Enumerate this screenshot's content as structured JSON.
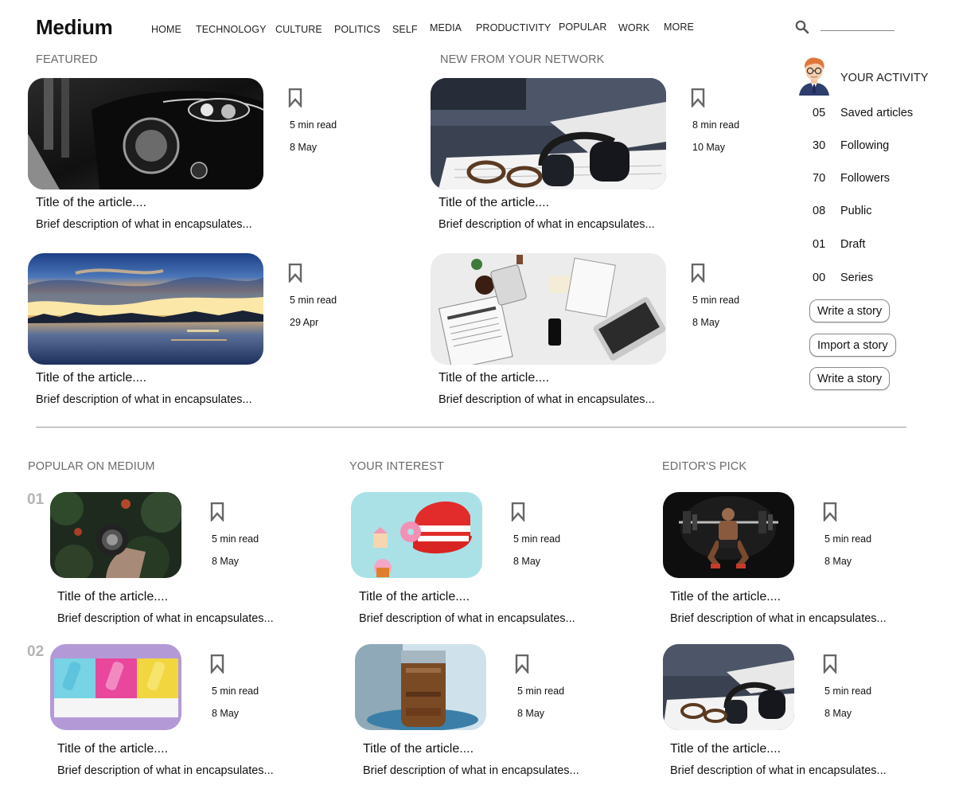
{
  "header": {
    "logo": "Medium",
    "nav": [
      "HOME",
      "TECHNOLOGY",
      "CULTURE",
      "POLITICS",
      "SELF",
      "MEDIA",
      "PRODUCTIVITY",
      "POPULAR",
      "WORK",
      "MORE"
    ],
    "search_icon": "search-icon"
  },
  "featured": {
    "title": "FEATURED",
    "articles": [
      {
        "read_time": "5 min read",
        "date": "8 May",
        "title": "Title of the article....",
        "desc": "Brief description of what in encapsulates..."
      },
      {
        "read_time": "5 min read",
        "date": "29 Apr",
        "title": "Title of the article....",
        "desc": "Brief description of what in encapsulates..."
      }
    ]
  },
  "network": {
    "title": "NEW FROM YOUR NETWORK",
    "articles": [
      {
        "read_time": "8 min read",
        "date": "10 May",
        "title": "Title of the article....",
        "desc": "Brief description of what in encapsulates..."
      },
      {
        "read_time": "5 min read",
        "date": "8 May",
        "title": "Title of the article....",
        "desc": "Brief description of what in encapsulates..."
      }
    ]
  },
  "activity": {
    "title": "YOUR ACTIVITY",
    "stats": [
      {
        "num": "05",
        "label": "Saved articles"
      },
      {
        "num": "30",
        "label": "Following"
      },
      {
        "num": "70",
        "label": "Followers"
      },
      {
        "num": "08",
        "label": "Public"
      },
      {
        "num": "01",
        "label": "Draft"
      },
      {
        "num": "00",
        "label": "Series"
      }
    ],
    "buttons": [
      "Write a story",
      "Import a story",
      "Write a story"
    ]
  },
  "popular": {
    "title": "POPULAR ON MEDIUM",
    "ranks": [
      "01",
      "02"
    ],
    "articles": [
      {
        "read_time": "5 min read",
        "date": "8 May",
        "title": "Title of the article....",
        "desc": "Brief description of what in encapsulates..."
      },
      {
        "read_time": "5 min read",
        "date": "8 May",
        "title": "Title of the article....",
        "desc": "Brief description of what in encapsulates..."
      }
    ]
  },
  "interest": {
    "title": "YOUR INTEREST",
    "articles": [
      {
        "read_time": "5 min read",
        "date": "8 May",
        "title": "Title of the article....",
        "desc": "Brief description of what in encapsulates..."
      },
      {
        "read_time": "5 min read",
        "date": "8 May",
        "title": "Title of the article....",
        "desc": "Brief description of what in encapsulates..."
      }
    ]
  },
  "editors": {
    "title": "EDITOR'S PICK",
    "articles": [
      {
        "read_time": "5 min read",
        "date": "8 May",
        "title": "Title of the article....",
        "desc": "Brief description of what in encapsulates..."
      },
      {
        "read_time": "5 min read",
        "date": "8 May",
        "title": "Title of the article....",
        "desc": "Brief description of what in encapsulates..."
      }
    ]
  },
  "icons": {
    "bookmark": "bookmark-icon",
    "avatar": "user-avatar"
  }
}
